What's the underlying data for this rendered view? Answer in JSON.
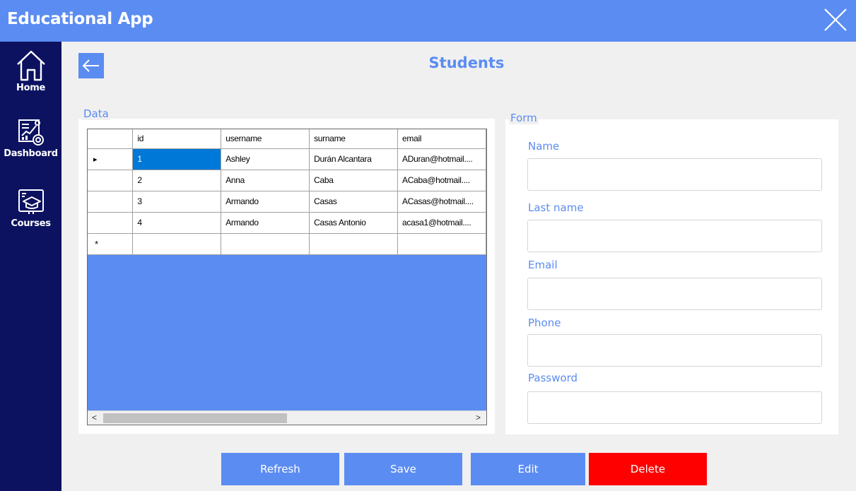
{
  "app": {
    "title": "Educational App"
  },
  "sidebar": {
    "items": [
      {
        "label": "Home",
        "icon": "home-icon"
      },
      {
        "label": "Dashboard",
        "icon": "dashboard-icon"
      },
      {
        "label": "Courses",
        "icon": "graduation-cap-icon"
      }
    ]
  },
  "page": {
    "title": "Students"
  },
  "data_panel": {
    "legend": "Data",
    "columns": [
      "id",
      "username",
      "surname",
      "email"
    ],
    "rows": [
      [
        "1",
        "Ashley",
        "Durán Alcantara",
        "ADuran@hotmail...."
      ],
      [
        "2",
        "Anna",
        "Caba",
        "ACaba@hotmail...."
      ],
      [
        "3",
        "Armando",
        "Casas",
        "ACasas@hotmail...."
      ],
      [
        "4",
        "Armando",
        "Casas Antonio",
        "acasa1@hotmail...."
      ]
    ],
    "new_row_marker": "*",
    "selected_row_marker": "▸"
  },
  "form_panel": {
    "legend": "Form",
    "fields": [
      {
        "label": "Name",
        "value": ""
      },
      {
        "label": "Last name",
        "value": ""
      },
      {
        "label": "Email",
        "value": ""
      },
      {
        "label": "Phone",
        "value": ""
      },
      {
        "label": "Password",
        "value": ""
      }
    ]
  },
  "actions": {
    "refresh": "Refresh",
    "save": "Save",
    "edit": "Edit",
    "delete": "Delete"
  },
  "colors": {
    "accent": "#5b8cf2",
    "sidebar": "#0c1260",
    "danger": "#ff0000",
    "selection": "#0078d7"
  }
}
